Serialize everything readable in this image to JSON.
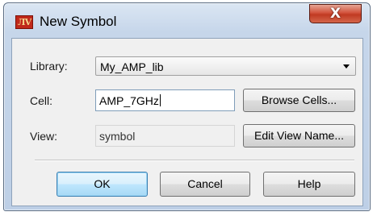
{
  "window": {
    "title": "New Symbol",
    "app_icon_text": "ЛV",
    "close_glyph": "X",
    "close_color": "#c7402a"
  },
  "form": {
    "library": {
      "label": "Library:",
      "value": "My_AMP_lib"
    },
    "cell": {
      "label": "Cell:",
      "value": "AMP_7GHz"
    },
    "view": {
      "label": "View:",
      "value": "symbol"
    }
  },
  "buttons": {
    "browse_cells": "Browse Cells...",
    "edit_view_name": "Edit View Name...",
    "ok": "OK",
    "cancel": "Cancel",
    "help": "Help"
  },
  "icons": {
    "app": "app-logo-icon",
    "close": "close-icon",
    "dropdown": "chevron-down-icon"
  }
}
